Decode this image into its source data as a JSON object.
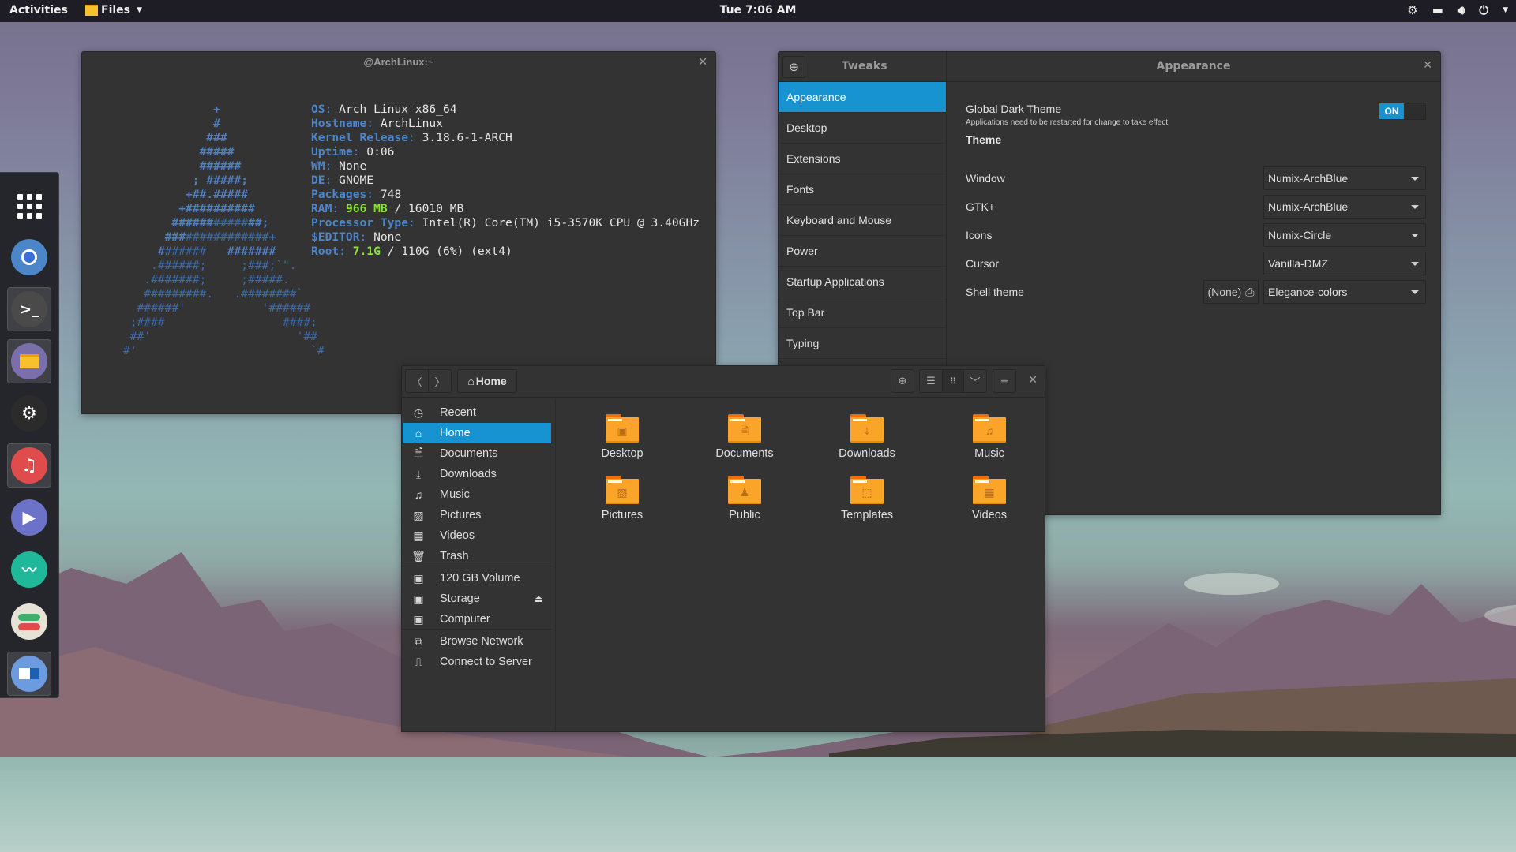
{
  "topbar": {
    "activities": "Activities",
    "app_menu": "Files",
    "clock": "Tue  7:06 AM",
    "tray_icons": [
      "steam-icon",
      "network-wired-icon",
      "volume-icon",
      "power-icon"
    ]
  },
  "dock": {
    "items": [
      {
        "name": "show-applications",
        "icon": "apps-grid-icon"
      },
      {
        "name": "chromium",
        "icon": "chromium-icon",
        "color": "#4a86c8"
      },
      {
        "name": "terminal",
        "icon": "terminal-icon",
        "color": "#4a4a4a",
        "running": true
      },
      {
        "name": "files",
        "icon": "folder-icon",
        "color": "#7b6fab",
        "running": true
      },
      {
        "name": "steam",
        "icon": "steam-icon",
        "color": "#2b2b2b"
      },
      {
        "name": "music",
        "icon": "music-note-icon",
        "color": "#e04b4b",
        "running": true
      },
      {
        "name": "video-player",
        "icon": "play-icon",
        "color": "#6b72c8"
      },
      {
        "name": "system-monitor",
        "icon": "pulse-icon",
        "color": "#1fb89a"
      },
      {
        "name": "tweaks",
        "icon": "toggles-icon",
        "color": "#e6e2d6"
      },
      {
        "name": "settings",
        "icon": "window-toggle-icon",
        "color": "#6d9be0",
        "running": true
      }
    ]
  },
  "terminal": {
    "title": "@ArchLinux:~",
    "ascii_art": [
      "                  +",
      "                  #",
      "                 ###",
      "                #####",
      "                ######",
      "               ; #####;",
      "              +##.#####",
      "             +##########",
      "            ######|#####|##;",
      "           ###|############|+",
      "          #|######   |#######",
      "         |.######;     ;###;`\".",
      "        |.#######;     ;#####.",
      "        |#########.   .########`",
      "       |######'           '######",
      "      |;####                 ####;",
      "      |##'                     '##",
      "     |#'                         `#"
    ],
    "info": [
      {
        "key": "OS",
        "value": "Arch Linux x86_64"
      },
      {
        "key": "Hostname",
        "value": "ArchLinux"
      },
      {
        "key": "Kernel Release",
        "value": "3.18.6-1-ARCH"
      },
      {
        "key": "Uptime",
        "value": "0:06"
      },
      {
        "key": "WM",
        "value": "None"
      },
      {
        "key": "DE",
        "value": "GNOME"
      },
      {
        "key": "Packages",
        "value": "748"
      },
      {
        "key": "RAM",
        "value_highlight": "966 MB",
        "value": " / 16010 MB"
      },
      {
        "key": "Processor Type",
        "value": "Intel(R) Core(TM) i5-3570K CPU @ 3.40GHz"
      },
      {
        "key": "$EDITOR",
        "value": "None"
      },
      {
        "key": "Root",
        "value_highlight": "7.1G",
        "value": " / 110G (6%) (ext4)"
      }
    ]
  },
  "tweaks": {
    "title_left": "Tweaks",
    "title_right": "Appearance",
    "sidebar": [
      "Appearance",
      "Desktop",
      "Extensions",
      "Fonts",
      "Keyboard and Mouse",
      "Power",
      "Startup Applications",
      "Top Bar",
      "Typing"
    ],
    "active_index": 0,
    "dark_theme": {
      "label": "Global Dark Theme",
      "sublabel": "Applications need to be restarted for change to take effect",
      "state": "ON"
    },
    "theme_heading": "Theme",
    "rows": [
      {
        "label": "Window",
        "value": "Numix-ArchBlue"
      },
      {
        "label": "GTK+",
        "value": "Numix-ArchBlue"
      },
      {
        "label": "Icons",
        "value": "Numix-Circle"
      },
      {
        "label": "Cursor",
        "value": "Vanilla-DMZ"
      },
      {
        "label": "Shell theme",
        "value": "Elegance-colors",
        "extra_button": "(None)"
      }
    ],
    "accent": "#1793d1"
  },
  "files": {
    "path": "Home",
    "sidebar": [
      {
        "label": "Recent",
        "icon": "clock-icon"
      },
      {
        "label": "Home",
        "icon": "home-icon",
        "active": true
      },
      {
        "label": "Documents",
        "icon": "document-icon"
      },
      {
        "label": "Downloads",
        "icon": "download-icon"
      },
      {
        "label": "Music",
        "icon": "music-icon"
      },
      {
        "label": "Pictures",
        "icon": "picture-icon"
      },
      {
        "label": "Videos",
        "icon": "film-icon"
      },
      {
        "label": "Trash",
        "icon": "trash-icon"
      },
      {
        "label": "120 GB Volume",
        "icon": "drive-icon"
      },
      {
        "label": "Storage",
        "icon": "drive-icon",
        "ejectable": true
      },
      {
        "label": "Computer",
        "icon": "drive-icon"
      },
      {
        "label": "Browse Network",
        "icon": "network-icon"
      },
      {
        "label": "Connect to Server",
        "icon": "server-icon"
      }
    ],
    "folders": [
      {
        "label": "Desktop",
        "emblem": "monitor-icon"
      },
      {
        "label": "Documents",
        "emblem": "document-icon"
      },
      {
        "label": "Downloads",
        "emblem": "download-icon"
      },
      {
        "label": "Music",
        "emblem": "music-icon"
      },
      {
        "label": "Pictures",
        "emblem": "picture-icon"
      },
      {
        "label": "Public",
        "emblem": "people-icon"
      },
      {
        "label": "Templates",
        "emblem": "template-icon"
      },
      {
        "label": "Videos",
        "emblem": "film-icon"
      }
    ],
    "folder_color": "#faa529"
  }
}
